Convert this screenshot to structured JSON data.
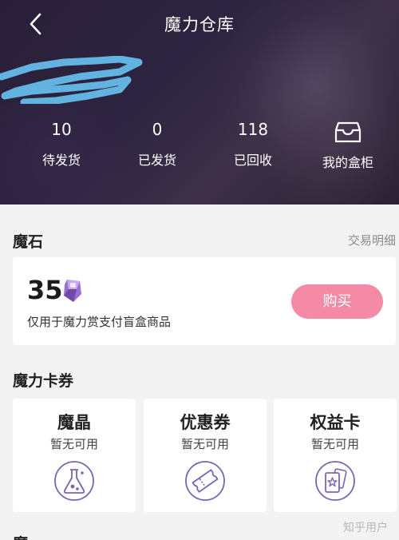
{
  "header": {
    "title": "魔力仓库",
    "stats": [
      {
        "value": "10",
        "label": "待发货"
      },
      {
        "value": "0",
        "label": "已发货"
      },
      {
        "value": "118",
        "label": "已回收"
      }
    ],
    "box_label": "我的盒柜"
  },
  "magic_stone": {
    "section_title": "魔石",
    "link": "交易明细",
    "amount": "35",
    "description": "仅用于魔力赏支付盲盒商品",
    "buy_label": "购买"
  },
  "coupons": {
    "section_title": "魔力卡券",
    "items": [
      {
        "name": "魔晶",
        "status": "暂无可用",
        "icon": "flask-icon"
      },
      {
        "name": "优惠券",
        "status": "暂无可用",
        "icon": "ticket-icon"
      },
      {
        "name": "权益卡",
        "status": "暂无可用",
        "icon": "star-card-icon"
      }
    ]
  },
  "next_section_title": "魔",
  "watermark": "知乎用户",
  "colors": {
    "accent": "#f58aa6",
    "header_bg": "#2c2440",
    "icon_purple": "#7a66b0",
    "redact_scribble": "#63b3e0"
  }
}
